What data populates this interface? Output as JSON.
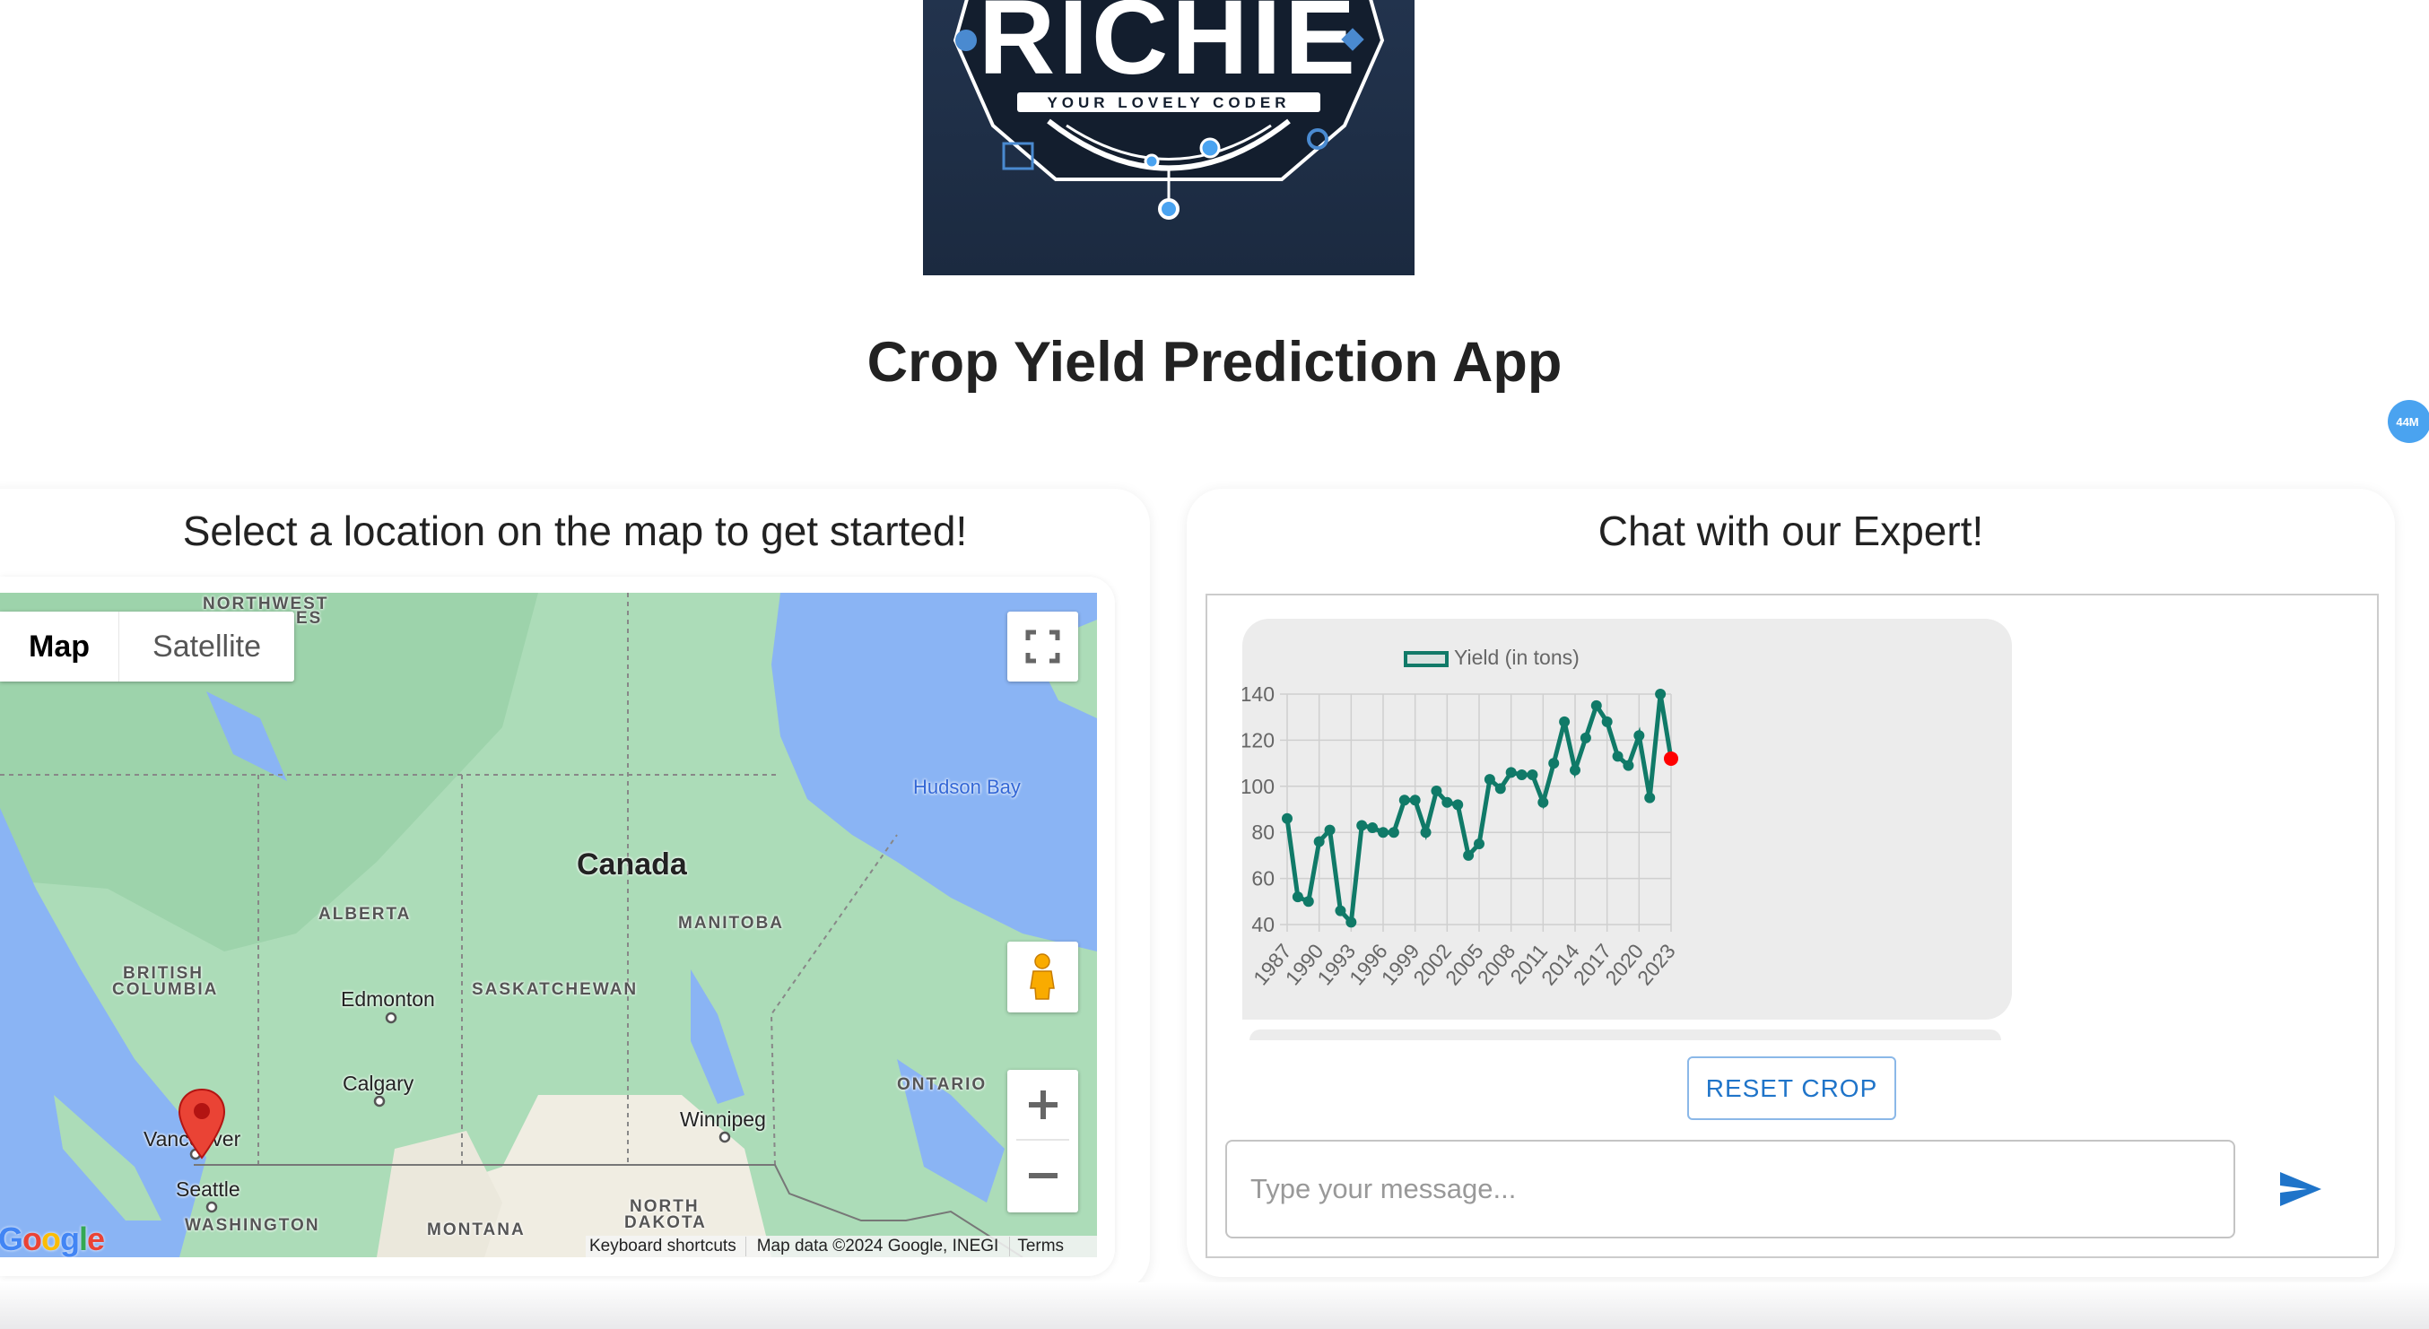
{
  "logo": {
    "text": "RICHIE",
    "tagline": "YOUR LOVELY CODER"
  },
  "header": {
    "title": "Crop Yield Prediction App",
    "badge": "44M"
  },
  "map_panel": {
    "heading": "Select a location on the map to get started!",
    "map_type_buttons": [
      "Map",
      "Satellite"
    ],
    "selected_map_type": "Map",
    "labels": {
      "northwest": "NORTHWEST",
      "northwest2": "ES",
      "hudson_bay": "Hudson Bay",
      "canada": "Canada",
      "alberta": "ALBERTA",
      "manitoba": "MANITOBA",
      "british_columbia_1": "BRITISH",
      "british_columbia_2": "COLUMBIA",
      "edmonton": "Edmonton",
      "saskatchewan": "SASKATCHEWAN",
      "calgary": "Calgary",
      "ontario": "ONTARIO",
      "winnipeg": "Winnipeg",
      "vancouver": "Vancouver",
      "seattle": "Seattle",
      "washington": "WASHINGTON",
      "north_dakota_1": "NORTH",
      "north_dakota_2": "DAKOTA",
      "montana": "MONTANA"
    },
    "google_logo": "Google",
    "attribution": {
      "shortcuts": "Keyboard shortcuts",
      "data": "Map data ©2024 Google, INEGI",
      "terms": "Terms"
    },
    "marker_color": "#ea4335"
  },
  "chat_panel": {
    "heading": "Chat with our Expert!",
    "reset_label": "RESET CROP",
    "input_value": "",
    "input_placeholder": "Type your message...",
    "accent": "#1f74c9"
  },
  "chart_data": {
    "type": "line",
    "legend": "Yield (in tons)",
    "legend_placement": "top",
    "grid": true,
    "line_color": "#107a68",
    "highlight_color": "#ff0000",
    "x": [
      1987,
      1988,
      1989,
      1990,
      1991,
      1992,
      1993,
      1994,
      1995,
      1996,
      1997,
      1998,
      1999,
      2000,
      2001,
      2002,
      2003,
      2004,
      2005,
      2006,
      2007,
      2008,
      2009,
      2010,
      2011,
      2012,
      2013,
      2014,
      2015,
      2016,
      2017,
      2018,
      2019,
      2020,
      2021,
      2022,
      2023
    ],
    "values": [
      86,
      52,
      50,
      76,
      81,
      46,
      41,
      83,
      82,
      80,
      80,
      94,
      94,
      80,
      98,
      93,
      92,
      70,
      75,
      103,
      99,
      106,
      105,
      105,
      93,
      110,
      128,
      107,
      121,
      135,
      128,
      113,
      109,
      122,
      95,
      140,
      112
    ],
    "highlighted_x": 2023,
    "xticks": [
      "1987",
      "1990",
      "1993",
      "1996",
      "1999",
      "2002",
      "2005",
      "2008",
      "2011",
      "2014",
      "2017",
      "2020",
      "2023"
    ],
    "yticks": [
      "40",
      "60",
      "80",
      "100",
      "120",
      "140"
    ],
    "ylim": [
      40,
      140
    ]
  }
}
